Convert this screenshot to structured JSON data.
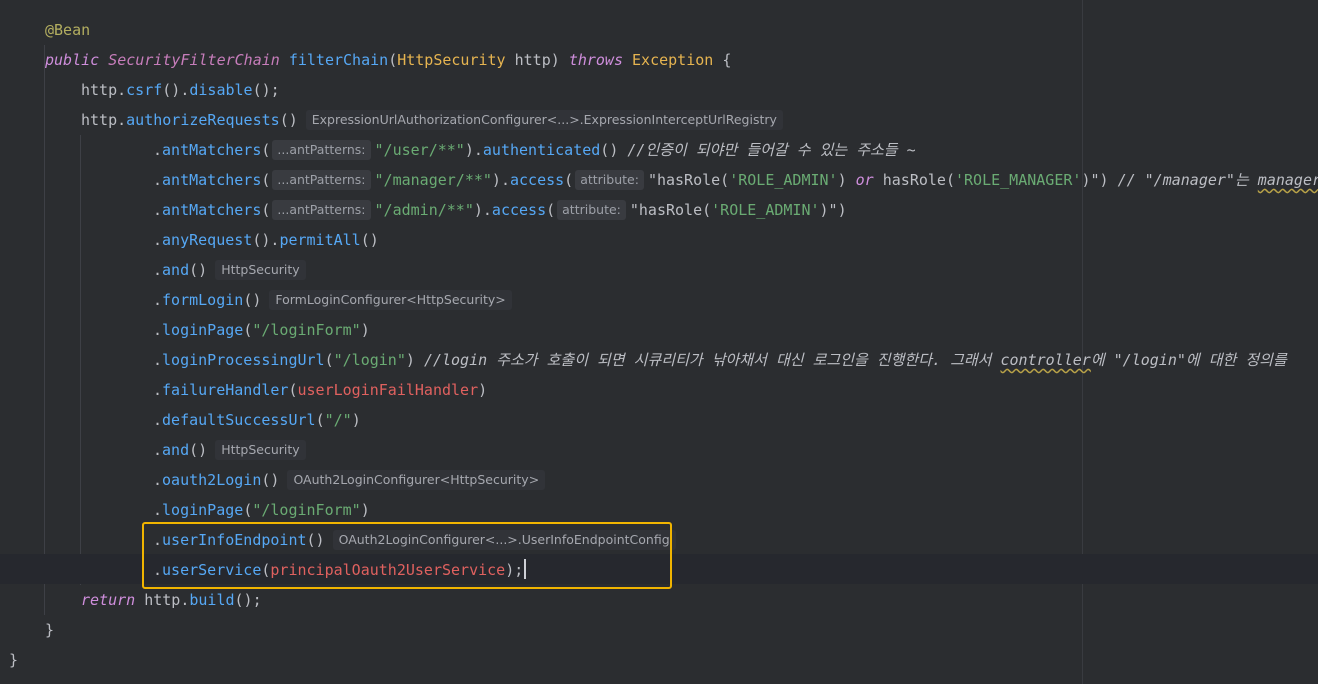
{
  "editor": {
    "language": "java",
    "colors": {
      "background": "#2b2d30",
      "highlight_box": "#f0b400",
      "annotation": "#b3ae60",
      "keyword": "#cf8edc",
      "method": "#56a8f5",
      "string": "#6aab73",
      "field": "#c77dbb",
      "field_red": "#e0615f"
    },
    "highlighted_lines": [
      18,
      19
    ],
    "lines": [
      {
        "indent": 45,
        "tokens": [
          {
            "c": "ann",
            "t": "@Bean"
          }
        ]
      },
      {
        "indent": 45,
        "tokens": [
          {
            "c": "kwi",
            "t": "public"
          },
          {
            "c": "sp",
            "t": " "
          },
          {
            "c": "type",
            "t": "SecurityFilterChain"
          },
          {
            "c": "sp",
            "t": " "
          },
          {
            "c": "fn",
            "t": "filterChain"
          },
          {
            "c": "plain",
            "t": "("
          },
          {
            "c": "cls-o",
            "t": "HttpSecurity"
          },
          {
            "c": "plain",
            "t": " http) "
          },
          {
            "c": "kwi",
            "t": "throws"
          },
          {
            "c": "plain",
            "t": " "
          },
          {
            "c": "cls-o",
            "t": "Exception"
          },
          {
            "c": "plain",
            "t": " {"
          }
        ]
      },
      {
        "indent": 81,
        "tokens": [
          {
            "c": "plain",
            "t": "http."
          },
          {
            "c": "method",
            "t": "csrf"
          },
          {
            "c": "plain",
            "t": "()."
          },
          {
            "c": "method",
            "t": "disable"
          },
          {
            "c": "plain",
            "t": "();"
          }
        ]
      },
      {
        "indent": 81,
        "tokens": [
          {
            "c": "plain",
            "t": "http."
          },
          {
            "c": "method",
            "t": "authorizeRequests"
          },
          {
            "c": "plain",
            "t": "()"
          },
          {
            "c": "typehint",
            "t": "ExpressionUrlAuthorizationConfigurer<...>.ExpressionInterceptUrlRegistry"
          }
        ]
      },
      {
        "indent": 153,
        "tokens": [
          {
            "c": "plain",
            "t": "."
          },
          {
            "c": "method",
            "t": "antMatchers"
          },
          {
            "c": "plain",
            "t": "("
          },
          {
            "c": "hint",
            "t": "...antPatterns:"
          },
          {
            "c": "str",
            "t": "\"/user/**\""
          },
          {
            "c": "plain",
            "t": ")."
          },
          {
            "c": "method",
            "t": "authenticated"
          },
          {
            "c": "plain",
            "t": "() "
          },
          {
            "c": "cmt",
            "t": "//인증이 되야만 들어갈 수 있는 주소들 ~"
          }
        ]
      },
      {
        "indent": 153,
        "tokens": [
          {
            "c": "plain",
            "t": "."
          },
          {
            "c": "method",
            "t": "antMatchers"
          },
          {
            "c": "plain",
            "t": "("
          },
          {
            "c": "hint",
            "t": "...antPatterns:"
          },
          {
            "c": "str",
            "t": "\"/manager/**\""
          },
          {
            "c": "plain",
            "t": ")."
          },
          {
            "c": "method",
            "t": "access"
          },
          {
            "c": "plain",
            "t": "("
          },
          {
            "c": "hint",
            "t": "attribute:"
          },
          {
            "c": "plain",
            "t": "\"hasRole("
          },
          {
            "c": "str",
            "t": "'ROLE_ADMIN'"
          },
          {
            "c": "plain",
            "t": ") "
          },
          {
            "c": "kwi",
            "t": "or"
          },
          {
            "c": "plain",
            "t": " hasRole("
          },
          {
            "c": "str",
            "t": "'ROLE_MANAGER'"
          },
          {
            "c": "plain",
            "t": ")\") "
          },
          {
            "c": "cmt",
            "t": "// \"/manager\"는 "
          },
          {
            "c": "cmtu",
            "t": "manager와"
          }
        ]
      },
      {
        "indent": 153,
        "tokens": [
          {
            "c": "plain",
            "t": "."
          },
          {
            "c": "method",
            "t": "antMatchers"
          },
          {
            "c": "plain",
            "t": "("
          },
          {
            "c": "hint",
            "t": "...antPatterns:"
          },
          {
            "c": "str",
            "t": "\"/admin/**\""
          },
          {
            "c": "plain",
            "t": ")."
          },
          {
            "c": "method",
            "t": "access"
          },
          {
            "c": "plain",
            "t": "("
          },
          {
            "c": "hint",
            "t": "attribute:"
          },
          {
            "c": "plain",
            "t": "\"hasRole("
          },
          {
            "c": "str",
            "t": "'ROLE_ADMIN'"
          },
          {
            "c": "plain",
            "t": ")\")"
          }
        ]
      },
      {
        "indent": 153,
        "tokens": [
          {
            "c": "plain",
            "t": "."
          },
          {
            "c": "method",
            "t": "anyRequest"
          },
          {
            "c": "plain",
            "t": "()."
          },
          {
            "c": "method",
            "t": "permitAll"
          },
          {
            "c": "plain",
            "t": "()"
          }
        ]
      },
      {
        "indent": 153,
        "tokens": [
          {
            "c": "plain",
            "t": "."
          },
          {
            "c": "method",
            "t": "and"
          },
          {
            "c": "plain",
            "t": "()"
          },
          {
            "c": "typehint",
            "t": "HttpSecurity"
          }
        ]
      },
      {
        "indent": 153,
        "tokens": [
          {
            "c": "plain",
            "t": "."
          },
          {
            "c": "method",
            "t": "formLogin"
          },
          {
            "c": "plain",
            "t": "()"
          },
          {
            "c": "typehint",
            "t": "FormLoginConfigurer<HttpSecurity>"
          }
        ]
      },
      {
        "indent": 153,
        "tokens": [
          {
            "c": "plain",
            "t": "."
          },
          {
            "c": "method",
            "t": "loginPage"
          },
          {
            "c": "plain",
            "t": "("
          },
          {
            "c": "str",
            "t": "\"/loginForm\""
          },
          {
            "c": "plain",
            "t": ")"
          }
        ]
      },
      {
        "indent": 153,
        "tokens": [
          {
            "c": "plain",
            "t": "."
          },
          {
            "c": "method",
            "t": "loginProcessingUrl"
          },
          {
            "c": "plain",
            "t": "("
          },
          {
            "c": "str",
            "t": "\"/login\""
          },
          {
            "c": "plain",
            "t": ") "
          },
          {
            "c": "cmt",
            "t": "//login 주소가 호출이 되면 시큐리티가 낚아채서 대신 로그인을 진행한다. 그래서 "
          },
          {
            "c": "cmtu",
            "t": "controller"
          },
          {
            "c": "cmt",
            "t": "에 \"/login\"에 대한 정의를"
          }
        ]
      },
      {
        "indent": 153,
        "tokens": [
          {
            "c": "plain",
            "t": "."
          },
          {
            "c": "method",
            "t": "failureHandler"
          },
          {
            "c": "plain",
            "t": "("
          },
          {
            "c": "fieldr",
            "t": "userLoginFailHandler"
          },
          {
            "c": "plain",
            "t": ")"
          }
        ]
      },
      {
        "indent": 153,
        "tokens": [
          {
            "c": "plain",
            "t": "."
          },
          {
            "c": "method",
            "t": "defaultSuccessUrl"
          },
          {
            "c": "plain",
            "t": "("
          },
          {
            "c": "str",
            "t": "\"/\""
          },
          {
            "c": "plain",
            "t": ")"
          }
        ]
      },
      {
        "indent": 153,
        "tokens": [
          {
            "c": "plain",
            "t": "."
          },
          {
            "c": "method",
            "t": "and"
          },
          {
            "c": "plain",
            "t": "()"
          },
          {
            "c": "typehint",
            "t": "HttpSecurity"
          }
        ]
      },
      {
        "indent": 153,
        "tokens": [
          {
            "c": "plain",
            "t": "."
          },
          {
            "c": "method",
            "t": "oauth2Login"
          },
          {
            "c": "plain",
            "t": "()"
          },
          {
            "c": "typehint",
            "t": "OAuth2LoginConfigurer<HttpSecurity>"
          }
        ]
      },
      {
        "indent": 153,
        "tokens": [
          {
            "c": "plain",
            "t": "."
          },
          {
            "c": "method",
            "t": "loginPage"
          },
          {
            "c": "plain",
            "t": "("
          },
          {
            "c": "str",
            "t": "\"/loginForm\""
          },
          {
            "c": "plain",
            "t": ")"
          }
        ]
      },
      {
        "indent": 153,
        "tokens": [
          {
            "c": "plain",
            "t": "."
          },
          {
            "c": "method",
            "t": "userInfoEndpoint"
          },
          {
            "c": "plain",
            "t": "()"
          },
          {
            "c": "typehint",
            "t": "OAuth2LoginConfigurer<...>.UserInfoEndpointConfig"
          }
        ]
      },
      {
        "indent": 153,
        "cursor": true,
        "tokens": [
          {
            "c": "plain",
            "t": "."
          },
          {
            "c": "method",
            "t": "userService"
          },
          {
            "c": "plain",
            "t": "("
          },
          {
            "c": "fieldr",
            "t": "principalOauth2UserService"
          },
          {
            "c": "plain",
            "t": ");"
          }
        ]
      },
      {
        "indent": 81,
        "tokens": [
          {
            "c": "kwi",
            "t": "return"
          },
          {
            "c": "plain",
            "t": " http."
          },
          {
            "c": "method",
            "t": "build"
          },
          {
            "c": "plain",
            "t": "();"
          }
        ]
      },
      {
        "indent": 45,
        "tokens": [
          {
            "c": "plain",
            "t": "}"
          }
        ]
      },
      {
        "indent": 9,
        "tokens": [
          {
            "c": "plain",
            "t": "}"
          }
        ]
      }
    ]
  }
}
